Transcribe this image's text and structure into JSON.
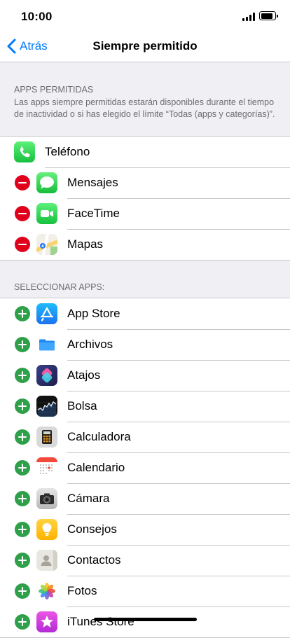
{
  "status_bar": {
    "time": "10:00",
    "battery_level": 0.9
  },
  "nav": {
    "back_label": "Atrás",
    "title": "Siempre permitido"
  },
  "allowed_section": {
    "title": "APPS PERMITIDAS",
    "description": "Las apps siempre permitidas estarán disponibles durante el tiempo de inactividad o si has elegido el límite “Todas (apps y categorías)”.",
    "apps": [
      {
        "label": "Teléfono",
        "icon": "phone-icon",
        "control": "none"
      },
      {
        "label": "Mensajes",
        "icon": "messages-icon",
        "control": "remove"
      },
      {
        "label": "FaceTime",
        "icon": "facetime-icon",
        "control": "remove"
      },
      {
        "label": "Mapas",
        "icon": "maps-icon",
        "control": "remove"
      }
    ]
  },
  "choose_section": {
    "title": "SELECCIONAR APPS:",
    "apps": [
      {
        "label": "App Store",
        "icon": "app-store-icon",
        "control": "add"
      },
      {
        "label": "Archivos",
        "icon": "files-icon",
        "control": "add"
      },
      {
        "label": "Atajos",
        "icon": "shortcuts-icon",
        "control": "add"
      },
      {
        "label": "Bolsa",
        "icon": "stocks-icon",
        "control": "add"
      },
      {
        "label": "Calculadora",
        "icon": "calculator-icon",
        "control": "add"
      },
      {
        "label": "Calendario",
        "icon": "calendar-icon",
        "control": "add"
      },
      {
        "label": "Cámara",
        "icon": "camera-icon",
        "control": "add"
      },
      {
        "label": "Consejos",
        "icon": "tips-icon",
        "control": "add"
      },
      {
        "label": "Contactos",
        "icon": "contacts-icon",
        "control": "add"
      },
      {
        "label": "Fotos",
        "icon": "photos-icon",
        "control": "add"
      },
      {
        "label": "iTunes Store",
        "icon": "itunes-store-icon",
        "control": "add"
      }
    ]
  },
  "colors": {
    "accent": "#007aff",
    "remove": "#e0001b",
    "add": "#2ea04a",
    "background": "#efeff4"
  }
}
